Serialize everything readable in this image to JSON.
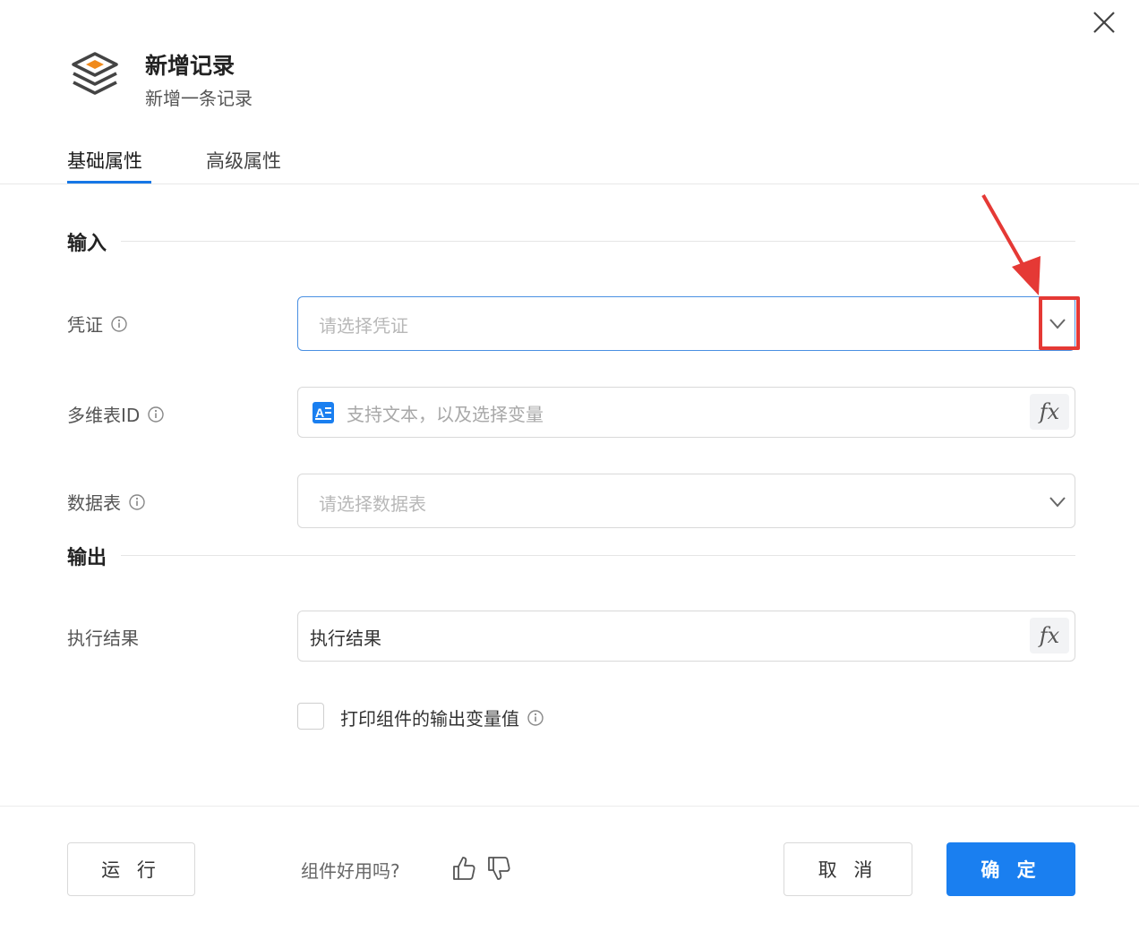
{
  "header": {
    "title": "新增记录",
    "subtitle": "新增一条记录",
    "icon": "layers-icon"
  },
  "tabs": [
    {
      "label": "基础属性",
      "active": true
    },
    {
      "label": "高级属性",
      "active": false
    }
  ],
  "sections": {
    "input_title": "输入",
    "output_title": "输出"
  },
  "fields": {
    "credential": {
      "label": "凭证",
      "placeholder": "请选择凭证"
    },
    "table_id": {
      "label": "多维表ID",
      "placeholder": "支持文本，以及选择变量",
      "fx": "fx"
    },
    "data_table": {
      "label": "数据表",
      "placeholder": "请选择数据表"
    },
    "result": {
      "label": "执行结果",
      "value": "执行结果",
      "fx": "fx"
    }
  },
  "print_option": {
    "label": "打印组件的输出变量值",
    "checked": false
  },
  "footer": {
    "run_label": "运 行",
    "feedback_text": "组件好用吗?",
    "cancel_label": "取 消",
    "ok_label": "确 定"
  },
  "colors": {
    "primary": "#1a7ff0",
    "annotation": "#e53935",
    "focus_border": "#4a90e2"
  }
}
